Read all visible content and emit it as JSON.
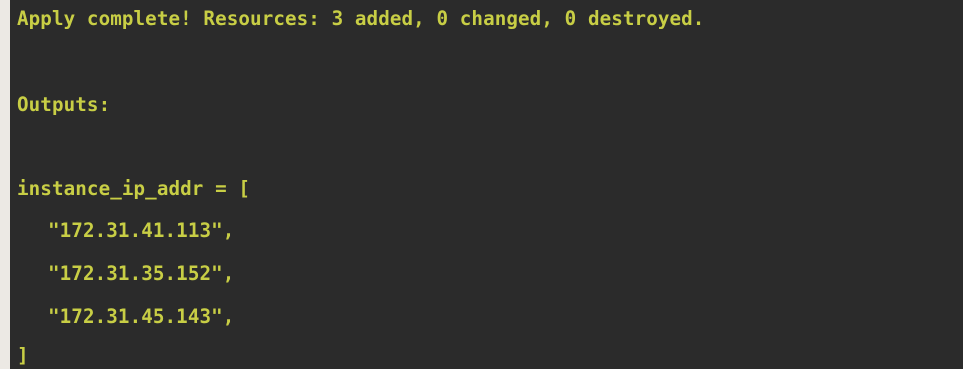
{
  "terminal": {
    "lines": [
      "Apply complete! Resources: 3 added, 0 changed, 0 destroyed.",
      "Outputs:",
      "instance_ip_addr = [",
      "\"172.31.41.113\",",
      "\"172.31.35.152\",",
      "\"172.31.45.143\",",
      "]"
    ],
    "text_color": "#c8ce45",
    "background_color": "#2b2b2b"
  }
}
